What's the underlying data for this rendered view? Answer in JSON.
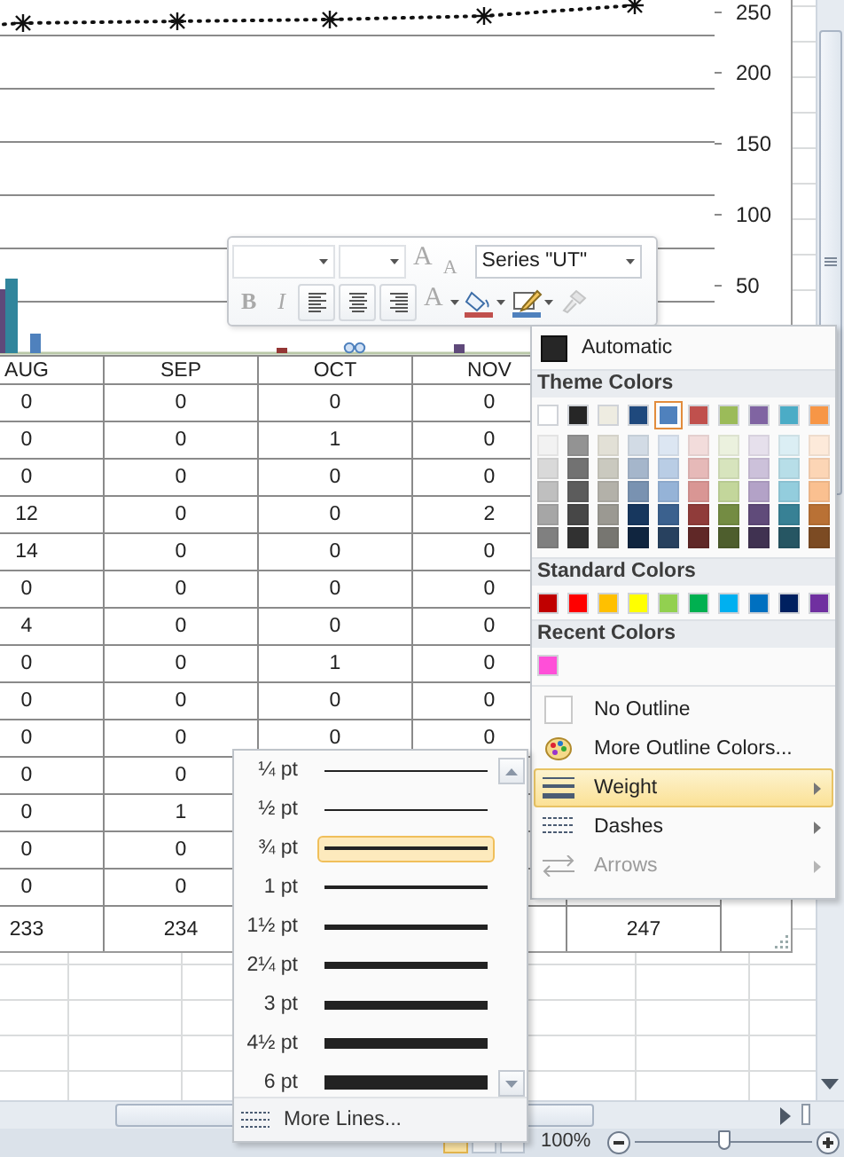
{
  "chart": {
    "axis_labels": [
      "250",
      "200",
      "150",
      "100",
      "50"
    ]
  },
  "data_table": {
    "columns": [
      {
        "header": "AUG",
        "values": [
          "0",
          "0",
          "0",
          "12",
          "14",
          "0",
          "4",
          "0",
          "0",
          "0",
          "0",
          "0",
          "0",
          "0"
        ],
        "total": "233"
      },
      {
        "header": "SEP",
        "values": [
          "0",
          "0",
          "0",
          "0",
          "0",
          "0",
          "0",
          "0",
          "0",
          "0",
          "0",
          "1",
          "0",
          "0"
        ],
        "total": "234"
      },
      {
        "header": "OCT",
        "values": [
          "0",
          "1",
          "0",
          "0",
          "0",
          "0",
          "0",
          "1",
          "0",
          "0"
        ]
      },
      {
        "header": "NOV",
        "values": [
          "0",
          "0",
          "0",
          "2",
          "0",
          "0",
          "0",
          "0",
          "0",
          "0"
        ]
      },
      {
        "total": "247"
      }
    ]
  },
  "mini_toolbar": {
    "rows": [
      [
        {
          "kind": "font-combo"
        },
        {
          "kind": "size-combo"
        },
        {
          "kind": "grow-font",
          "glyph": "A",
          "disabled": true
        },
        {
          "kind": "shrink-font",
          "glyph": "A",
          "disabled": true
        },
        {
          "kind": "series-combo",
          "value": "Series \"UT\""
        }
      ],
      [
        {
          "kind": "bold",
          "glyph": "B",
          "disabled": true
        },
        {
          "kind": "italic",
          "glyph": "I",
          "disabled": true
        },
        {
          "kind": "align-left"
        },
        {
          "kind": "align-center"
        },
        {
          "kind": "align-right"
        },
        {
          "kind": "font-color",
          "glyph": "A",
          "disabled": true
        },
        {
          "kind": "fill",
          "color": "#c0504d",
          "disabled": false
        },
        {
          "kind": "outline",
          "color": "#4f81bd",
          "disabled": false
        },
        {
          "kind": "painter",
          "disabled": true
        }
      ]
    ]
  },
  "color_menu": {
    "automatic": "Automatic",
    "theme_heading": "Theme Colors",
    "theme_colors": [
      {
        "color": "#ffffff",
        "selected": false
      },
      {
        "color": "#262626",
        "selected": false
      },
      {
        "color": "#eeece1",
        "selected": false
      },
      {
        "color": "#1f497d",
        "selected": false
      },
      {
        "color": "#4f81bd",
        "selected": true
      },
      {
        "color": "#c0504d",
        "selected": false
      },
      {
        "color": "#9bbb59",
        "selected": false
      },
      {
        "color": "#8064a2",
        "selected": false
      },
      {
        "color": "#4bacc6",
        "selected": false
      },
      {
        "color": "#f79646",
        "selected": false
      }
    ],
    "standard_heading": "Standard Colors",
    "standard_colors": [
      {
        "color": "#c00000",
        "selected": false
      },
      {
        "color": "#ff0000",
        "selected": false
      },
      {
        "color": "#ffc000",
        "selected": false
      },
      {
        "color": "#ffff00",
        "selected": false
      },
      {
        "color": "#92d050",
        "selected": false
      },
      {
        "color": "#00b050",
        "selected": false
      },
      {
        "color": "#00b0f0",
        "selected": false
      },
      {
        "color": "#0070c0",
        "selected": false
      },
      {
        "color": "#002060",
        "selected": false
      },
      {
        "color": "#7030a0",
        "selected": false
      }
    ],
    "recent_heading": "Recent Colors",
    "recent_colors": [
      {
        "color": "#ff4fd8",
        "selected": false
      }
    ],
    "items": [
      {
        "kind": "no-outline",
        "label": "No Outline",
        "expanded": false,
        "disabled": false
      },
      {
        "kind": "more-colors",
        "label": "More Outline Colors...",
        "expanded": false,
        "disabled": false
      },
      {
        "kind": "weight",
        "label": "Weight",
        "expanded": true,
        "disabled": false
      },
      {
        "kind": "dashes",
        "label": "Dashes",
        "expanded": false,
        "disabled": false
      },
      {
        "kind": "arrows",
        "label": "Arrows",
        "expanded": false,
        "disabled": true
      }
    ]
  },
  "weight_menu": {
    "items": [
      {
        "label": "¼ pt",
        "selected": false
      },
      {
        "label": "½ pt",
        "selected": false
      },
      {
        "label": "¾ pt",
        "selected": true
      },
      {
        "label": "1 pt",
        "selected": false
      },
      {
        "label": "1½ pt",
        "selected": false
      },
      {
        "label": "2¼ pt",
        "selected": false
      },
      {
        "label": "3 pt",
        "selected": false
      },
      {
        "label": "4½ pt",
        "selected": false
      },
      {
        "label": "6 pt",
        "selected": false
      }
    ],
    "more": "More Lines..."
  },
  "status_bar": {
    "zoom": "100%",
    "zoom_slider": {
      "level": 0.5
    }
  }
}
